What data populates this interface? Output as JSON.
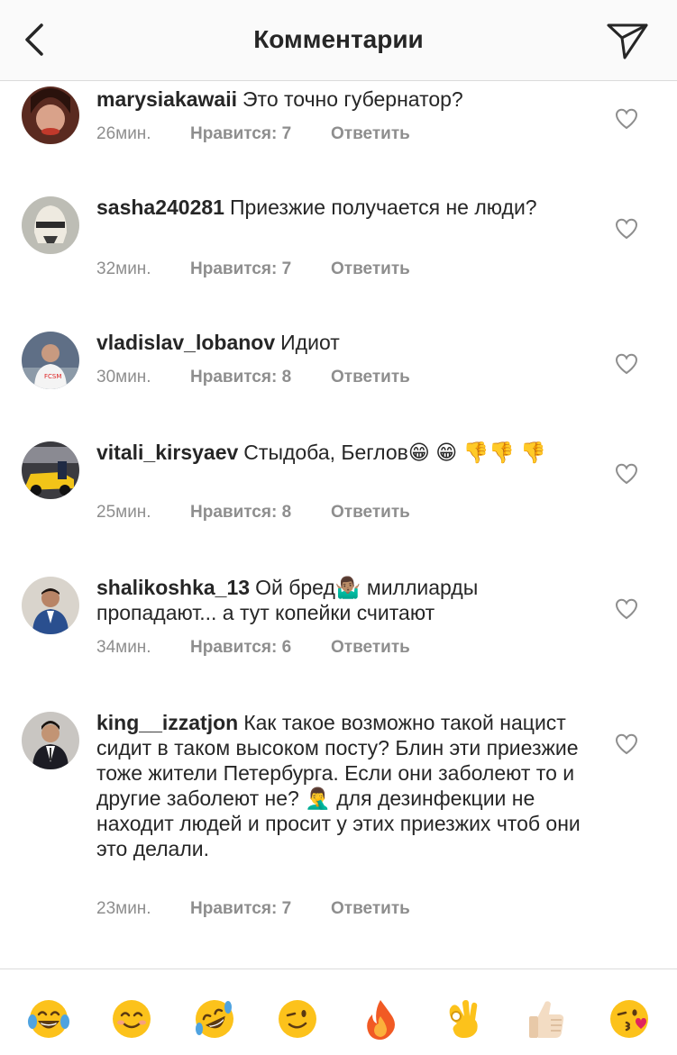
{
  "header": {
    "title": "Комментарии"
  },
  "comments": [
    {
      "user": "marysiakawaii",
      "text": "Это точно губернатор?",
      "time": "26мин.",
      "likes": "Нравится: 7",
      "reply": "Ответить"
    },
    {
      "user": "sasha240281",
      "text": "Приезжие получается не люди?",
      "time": "32мин.",
      "likes": "Нравится: 7",
      "reply": "Ответить"
    },
    {
      "user": "vladislav_lobanov",
      "text": "Идиот",
      "time": "30мин.",
      "likes": "Нравится: 8",
      "reply": "Ответить"
    },
    {
      "user": "vitali_kirsyaev",
      "text": "Стыдоба, Беглов😁 😁 👎👎 👎",
      "time": "25мин.",
      "likes": "Нравится: 8",
      "reply": "Ответить"
    },
    {
      "user": "shalikoshka_13",
      "text": "Ой бред🤷🏽‍♂️ миллиарды пропадают... а тут копейки считают",
      "time": "34мин.",
      "likes": "Нравится: 6",
      "reply": "Ответить"
    },
    {
      "user": "king__izzatjon",
      "text": "Как такое возможно такой нацист сидит в таком высоком посту? Блин эти приезжие тоже жители Петербурга. Если они заболеют то и другие заболеют не? 🤦‍♂️ для дезинфекции не находит людей и просит у этих приезжих чтоб они это делали.",
      "time": "23мин.",
      "likes": "Нравится: 7",
      "reply": "Ответить"
    }
  ],
  "emoji_bar": [
    "😂",
    "😊",
    "🤣",
    "😉",
    "🔥",
    "👌",
    "👍🏻",
    "😘"
  ]
}
